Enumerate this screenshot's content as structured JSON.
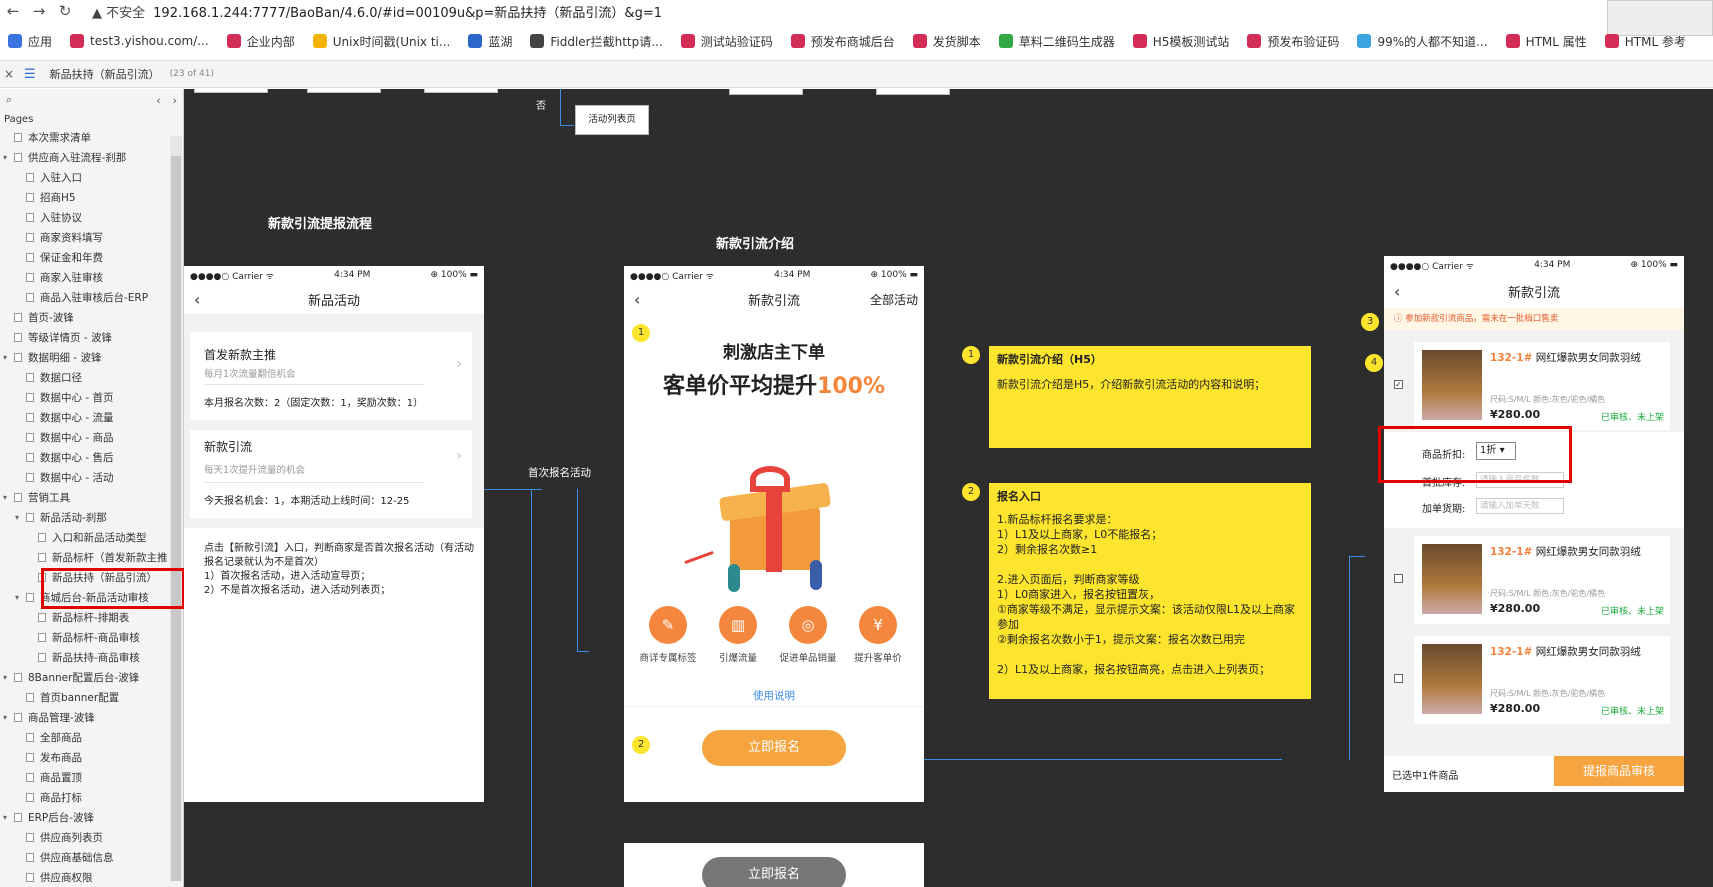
{
  "browser": {
    "warning": "不安全",
    "url": "192.168.1.244:7777/BaoBan/4.6.0/#id=00109u&p=新品扶持（新品引流）&g=1",
    "bookmarks": [
      "应用",
      "test3.yishou.com/...",
      "企业内部",
      "Unix时间戳(Unix ti...",
      "蓝湖",
      "Fiddler拦截http请...",
      "测试站验证码",
      "预发布商城后台",
      "发货脚本",
      "草料二维码生成器",
      "H5模板测试站",
      "预发布验证码",
      "99%的人都不知道...",
      "HTML 属性",
      "HTML 参考"
    ]
  },
  "pagebar": {
    "title": "新品扶持（新品引流）",
    "count": "(23 of 41)"
  },
  "sidebar": {
    "pages_label": "Pages",
    "items": [
      {
        "label": "本次需求清单",
        "level": 1,
        "exp": ""
      },
      {
        "label": "供应商入驻流程-刹那",
        "level": 1,
        "exp": "▾"
      },
      {
        "label": "入驻入口",
        "level": 2,
        "exp": ""
      },
      {
        "label": "招商H5",
        "level": 2,
        "exp": ""
      },
      {
        "label": "入驻协议",
        "level": 2,
        "exp": ""
      },
      {
        "label": "商家资料填写",
        "level": 2,
        "exp": ""
      },
      {
        "label": "保证金和年费",
        "level": 2,
        "exp": ""
      },
      {
        "label": "商家入驻审核",
        "level": 2,
        "exp": ""
      },
      {
        "label": "商品入驻审核后台-ERP",
        "level": 2,
        "exp": ""
      },
      {
        "label": "首页-波锋",
        "level": 1,
        "exp": ""
      },
      {
        "label": "等级详情页 - 波锋",
        "level": 1,
        "exp": ""
      },
      {
        "label": "数据明细 - 波锋",
        "level": 1,
        "exp": "▾"
      },
      {
        "label": "数据口径",
        "level": 2,
        "exp": ""
      },
      {
        "label": "数据中心 - 首页",
        "level": 2,
        "exp": ""
      },
      {
        "label": "数据中心 - 流量",
        "level": 2,
        "exp": ""
      },
      {
        "label": "数据中心 - 商品",
        "level": 2,
        "exp": ""
      },
      {
        "label": "数据中心 - 售后",
        "level": 2,
        "exp": ""
      },
      {
        "label": "数据中心 - 活动",
        "level": 2,
        "exp": ""
      },
      {
        "label": "营销工具",
        "level": 1,
        "exp": "▾"
      },
      {
        "label": "新品活动-刹那",
        "level": 2,
        "exp": "▾"
      },
      {
        "label": "入口和新品活动类型",
        "level": 3,
        "exp": ""
      },
      {
        "label": "新品标杆（首发新款主推",
        "level": 3,
        "exp": ""
      },
      {
        "label": "新品扶持（新品引流）",
        "level": 3,
        "exp": ""
      },
      {
        "label": "商城后台-新品活动审核",
        "level": 2,
        "exp": "▾"
      },
      {
        "label": "新品标杆-排期表",
        "level": 3,
        "exp": ""
      },
      {
        "label": "新品标杆-商品审核",
        "level": 3,
        "exp": ""
      },
      {
        "label": "新品扶持-商品审核",
        "level": 3,
        "exp": ""
      },
      {
        "label": "8Banner配置后台-波锋",
        "level": 1,
        "exp": "▾"
      },
      {
        "label": "首页banner配置",
        "level": 2,
        "exp": ""
      },
      {
        "label": "商品管理-波锋",
        "level": 1,
        "exp": "▾"
      },
      {
        "label": "全部商品",
        "level": 2,
        "exp": ""
      },
      {
        "label": "发布商品",
        "level": 2,
        "exp": ""
      },
      {
        "label": "商品置顶",
        "level": 2,
        "exp": ""
      },
      {
        "label": "商品打标",
        "level": 2,
        "exp": ""
      },
      {
        "label": "ERP后台-波锋",
        "level": 1,
        "exp": "▾"
      },
      {
        "label": "供应商列表页",
        "level": 2,
        "exp": ""
      },
      {
        "label": "供应商基础信息",
        "level": 2,
        "exp": ""
      },
      {
        "label": "供应商权限",
        "level": 2,
        "exp": ""
      }
    ]
  },
  "canvas": {
    "top_no": "否",
    "activity_list": "活动列表页",
    "flow_title": "新款引流提报流程",
    "intro_title": "新款引流介绍",
    "first_signup": "首次报名活动",
    "status": {
      "carrier": "●●●●○ Carrier ᯤ",
      "time": "4:34 PM",
      "battery": "⊕ 100% ▬"
    },
    "phone1": {
      "header": "新品活动",
      "card1": {
        "title": "首发新款主推",
        "sub": "每月1次流量翻倍机会",
        "info": "本月报名次数：2（固定次数：1，奖励次数：1）"
      },
      "card2": {
        "title": "新款引流",
        "sub": "每天1次提升流量的机会",
        "info": "今天报名机会：1，本期活动上线时间：12-25"
      },
      "note": "点击【新款引流】入口，判断商家是否首次报名活动（有活动报名记录就认为不是首次）\n1）首次报名活动，进入活动宣导页；\n2）不是首次报名活动，进入活动列表页；"
    },
    "phone2": {
      "header": "新款引流",
      "header_right": "全部活动",
      "badge1": "1",
      "line1": "刺激店主下单",
      "line2a": "客单价平均提升",
      "line2b": "100%",
      "features": [
        "商详专属标签",
        "引爆流量",
        "促进单品销量",
        "提升客单价"
      ],
      "usage": "使用说明",
      "badge2": "2",
      "signup": "立即报名",
      "signup2": "立即报名"
    },
    "note1": {
      "badge": "1",
      "title": "新款引流介绍（H5）",
      "body": "新款引流介绍是H5，介绍新款引流活动的内容和说明；"
    },
    "note2": {
      "badge": "2",
      "title": "报名入口",
      "body": "1.新品标杆报名要求是：\n1）L1及以上商家，L0不能报名；\n2）剩余报名次数≥1\n\n2.进入页面后，判断商家等级\n1）L0商家进入，报名按钮置灰，\n①商家等级不满足，显示提示文案：该活动仅限L1及以上商家参加\n②剩余报名次数小于1，提示文案：报名次数已用完\n\n2）L1及以上商家，报名按钮高亮，点击进入上列表页；"
    },
    "phone3": {
      "header": "新款引流",
      "badge3": "3",
      "badge4": "4",
      "tip": "参加新款引流商品，需未在一批档口售卖",
      "products": [
        {
          "code": "132-1#",
          "name": "网红爆款男女同款羽绒",
          "spec": "尺码:S/M/L    颜色:灰色/驼色/橘色",
          "price": "¥280.00",
          "state": "已审核、未上架"
        },
        {
          "code": "132-1#",
          "name": "网红爆款男女同款羽绒",
          "spec": "尺码:S/M/L    颜色:灰色/驼色/橘色",
          "price": "¥280.00",
          "state": "已审核、未上架"
        },
        {
          "code": "132-1#",
          "name": "网红爆款男女同款羽绒",
          "spec": "尺码:S/M/L    颜色:灰色/驼色/橘色",
          "price": "¥280.00",
          "state": "已审核、未上架"
        }
      ],
      "discount_label": "商品折扣:",
      "discount_value": "1折",
      "stock_label": "首批库存:",
      "stock_placeholder": "请输入商品件数",
      "days_label": "加单货期:",
      "days_placeholder": "请输入加单天数",
      "selected": "已选中1件商品",
      "submit": "提报商品审核"
    }
  }
}
